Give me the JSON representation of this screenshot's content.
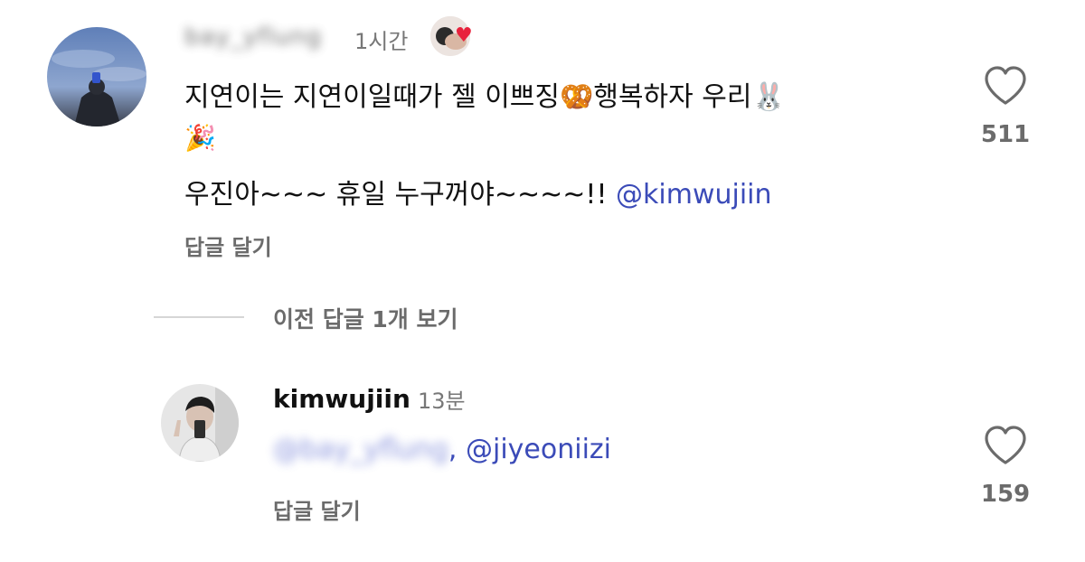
{
  "comment1": {
    "username": "bay_yflung",
    "time": "1시간",
    "reaction_heart": "♥",
    "text_line1": "지연이는 지연이일때가 젤 이쁘징🥨행복하자 우리🐰",
    "text_line2": "🎉",
    "text_line3_prefix": "우진아~~~ 휴일 누구꺼야~~~~!! ",
    "mention": "@kimwujiin",
    "reply_label": "답글 달기",
    "likes": "511",
    "like_icon": "heart-outline-icon"
  },
  "view_previous_replies": "이전 답글 1개 보기",
  "comment2": {
    "username": "kimwujiin",
    "time": "13분",
    "mention_blurred": "@bay_yflung",
    "separator": ", ",
    "mention": "@jiyeoniizi",
    "reply_label": "답글 달기",
    "likes": "159",
    "like_icon": "heart-outline-icon"
  },
  "colors": {
    "mention": "#3b4bb8",
    "secondary_text": "#6b6b6b",
    "heart": "#e8223c"
  }
}
